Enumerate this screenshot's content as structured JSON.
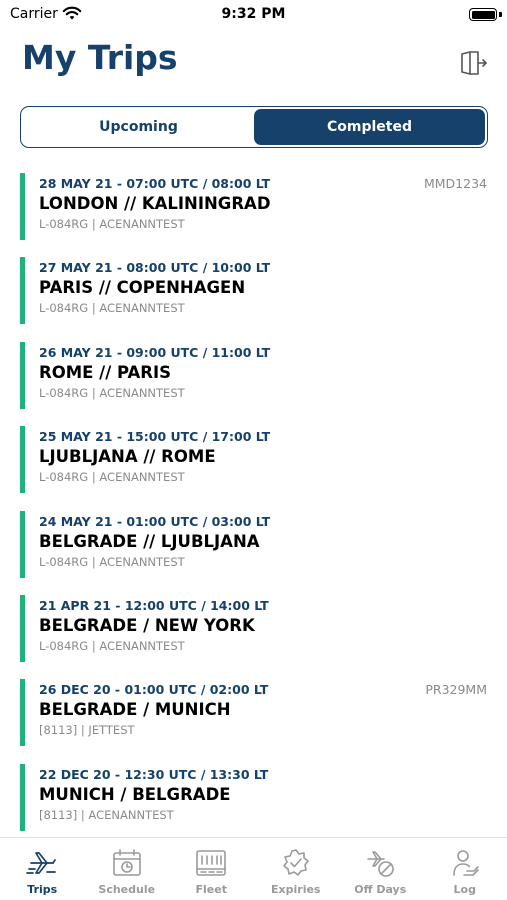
{
  "status_bar": {
    "carrier": "Carrier",
    "time": "9:32 PM"
  },
  "header": {
    "title": "My Trips"
  },
  "segments": {
    "upcoming": "Upcoming",
    "completed": "Completed",
    "selected": "Completed"
  },
  "trips": [
    {
      "time": "28 MAY 21 - 07:00 UTC / 08:00 LT",
      "route": "LONDON // KALININGRAD",
      "meta": "L-084RG | ACENANNTEST",
      "code": "MMD1234"
    },
    {
      "time": "27 MAY 21 - 08:00 UTC / 10:00 LT",
      "route": "PARIS // COPENHAGEN",
      "meta": "L-084RG | ACENANNTEST",
      "code": ""
    },
    {
      "time": "26 MAY 21 - 09:00 UTC / 11:00 LT",
      "route": "ROME // PARIS",
      "meta": "L-084RG | ACENANNTEST",
      "code": ""
    },
    {
      "time": "25 MAY 21 - 15:00 UTC / 17:00 LT",
      "route": "LJUBLJANA // ROME",
      "meta": "L-084RG | ACENANNTEST",
      "code": ""
    },
    {
      "time": "24 MAY 21 - 01:00 UTC / 03:00 LT",
      "route": "BELGRADE // LJUBLJANA",
      "meta": "L-084RG | ACENANNTEST",
      "code": ""
    },
    {
      "time": "21 APR 21 - 12:00 UTC / 14:00 LT",
      "route": "BELGRADE / NEW YORK",
      "meta": "L-084RG | ACENANNTEST",
      "code": ""
    },
    {
      "time": "26 DEC 20 - 01:00 UTC / 02:00 LT",
      "route": "BELGRADE / MUNICH",
      "meta": "[8113] | JETTEST",
      "code": "PR329MM"
    },
    {
      "time": "22 DEC 20 - 12:30 UTC / 13:30 LT",
      "route": "MUNICH / BELGRADE",
      "meta": "[8113] | ACENANNTEST",
      "code": ""
    }
  ],
  "tabbar": [
    {
      "label": "Trips",
      "icon": "trips-icon",
      "active": true
    },
    {
      "label": "Schedule",
      "icon": "calendar-icon",
      "active": false
    },
    {
      "label": "Fleet",
      "icon": "fleet-icon",
      "active": false
    },
    {
      "label": "Expiries",
      "icon": "expiries-icon",
      "active": false
    },
    {
      "label": "Off Days",
      "icon": "off-days-icon",
      "active": false
    },
    {
      "label": "Log",
      "icon": "log-icon",
      "active": false
    }
  ],
  "colors": {
    "primary": "#15416b",
    "accent_bar": "#1db37a",
    "muted": "#8a8a8a",
    "inactive_tab": "#9a9a9a"
  }
}
